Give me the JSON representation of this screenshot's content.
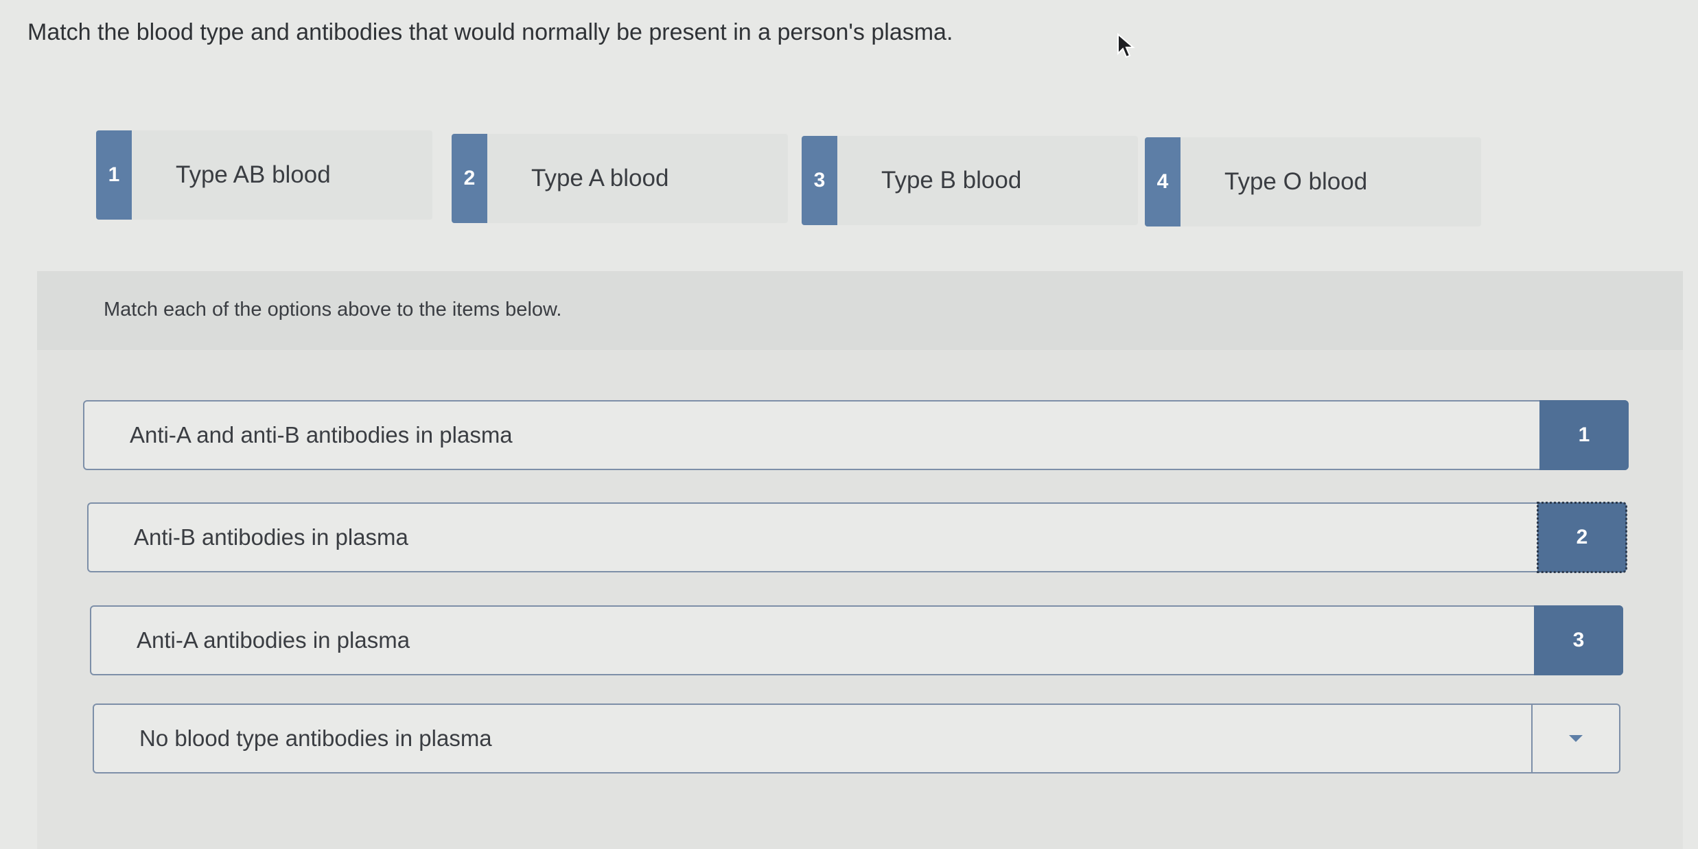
{
  "question": "Match the blood type and antibodies that would normally be present in a person's plasma.",
  "options": [
    {
      "number": "1",
      "label": "Type AB blood"
    },
    {
      "number": "2",
      "label": "Type A blood"
    },
    {
      "number": "3",
      "label": "Type B blood"
    },
    {
      "number": "4",
      "label": "Type O blood"
    }
  ],
  "instruction": "Match each of the options above to the items below.",
  "items": [
    {
      "text": "Anti-A and anti-B antibodies in plasma",
      "answer": "1"
    },
    {
      "text": "Anti-B antibodies in plasma",
      "answer": "2"
    },
    {
      "text": "Anti-A antibodies in plasma",
      "answer": "3"
    },
    {
      "text": "No blood type antibodies in plasma",
      "answer": ""
    }
  ],
  "colors": {
    "accent": "#5d7ea6",
    "answer_fill": "#4f6f96",
    "background": "#e7e8e6"
  },
  "icons": {
    "cursor": "mouse-pointer-icon",
    "dropdown": "caret-down-icon"
  }
}
